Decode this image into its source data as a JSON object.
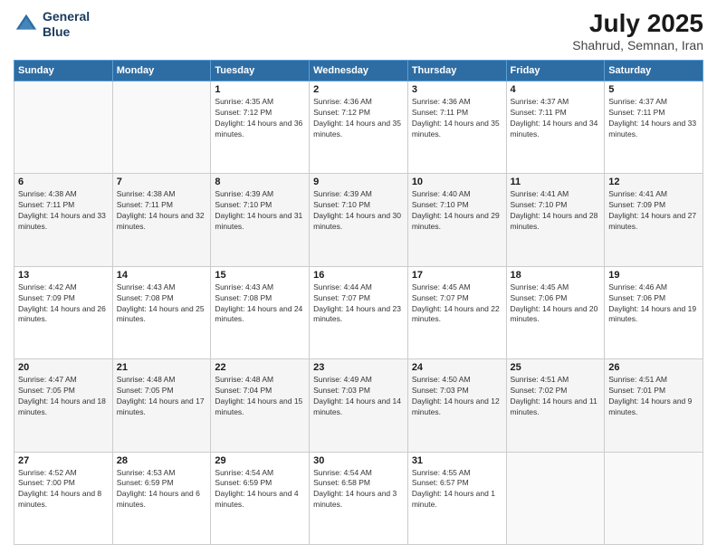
{
  "header": {
    "logo_line1": "General",
    "logo_line2": "Blue",
    "month": "July 2025",
    "location": "Shahrud, Semnan, Iran"
  },
  "weekdays": [
    "Sunday",
    "Monday",
    "Tuesday",
    "Wednesday",
    "Thursday",
    "Friday",
    "Saturday"
  ],
  "weeks": [
    [
      {
        "day": "",
        "sunrise": "",
        "sunset": "",
        "daylight": ""
      },
      {
        "day": "",
        "sunrise": "",
        "sunset": "",
        "daylight": ""
      },
      {
        "day": "1",
        "sunrise": "Sunrise: 4:35 AM",
        "sunset": "Sunset: 7:12 PM",
        "daylight": "Daylight: 14 hours and 36 minutes."
      },
      {
        "day": "2",
        "sunrise": "Sunrise: 4:36 AM",
        "sunset": "Sunset: 7:12 PM",
        "daylight": "Daylight: 14 hours and 35 minutes."
      },
      {
        "day": "3",
        "sunrise": "Sunrise: 4:36 AM",
        "sunset": "Sunset: 7:11 PM",
        "daylight": "Daylight: 14 hours and 35 minutes."
      },
      {
        "day": "4",
        "sunrise": "Sunrise: 4:37 AM",
        "sunset": "Sunset: 7:11 PM",
        "daylight": "Daylight: 14 hours and 34 minutes."
      },
      {
        "day": "5",
        "sunrise": "Sunrise: 4:37 AM",
        "sunset": "Sunset: 7:11 PM",
        "daylight": "Daylight: 14 hours and 33 minutes."
      }
    ],
    [
      {
        "day": "6",
        "sunrise": "Sunrise: 4:38 AM",
        "sunset": "Sunset: 7:11 PM",
        "daylight": "Daylight: 14 hours and 33 minutes."
      },
      {
        "day": "7",
        "sunrise": "Sunrise: 4:38 AM",
        "sunset": "Sunset: 7:11 PM",
        "daylight": "Daylight: 14 hours and 32 minutes."
      },
      {
        "day": "8",
        "sunrise": "Sunrise: 4:39 AM",
        "sunset": "Sunset: 7:10 PM",
        "daylight": "Daylight: 14 hours and 31 minutes."
      },
      {
        "day": "9",
        "sunrise": "Sunrise: 4:39 AM",
        "sunset": "Sunset: 7:10 PM",
        "daylight": "Daylight: 14 hours and 30 minutes."
      },
      {
        "day": "10",
        "sunrise": "Sunrise: 4:40 AM",
        "sunset": "Sunset: 7:10 PM",
        "daylight": "Daylight: 14 hours and 29 minutes."
      },
      {
        "day": "11",
        "sunrise": "Sunrise: 4:41 AM",
        "sunset": "Sunset: 7:10 PM",
        "daylight": "Daylight: 14 hours and 28 minutes."
      },
      {
        "day": "12",
        "sunrise": "Sunrise: 4:41 AM",
        "sunset": "Sunset: 7:09 PM",
        "daylight": "Daylight: 14 hours and 27 minutes."
      }
    ],
    [
      {
        "day": "13",
        "sunrise": "Sunrise: 4:42 AM",
        "sunset": "Sunset: 7:09 PM",
        "daylight": "Daylight: 14 hours and 26 minutes."
      },
      {
        "day": "14",
        "sunrise": "Sunrise: 4:43 AM",
        "sunset": "Sunset: 7:08 PM",
        "daylight": "Daylight: 14 hours and 25 minutes."
      },
      {
        "day": "15",
        "sunrise": "Sunrise: 4:43 AM",
        "sunset": "Sunset: 7:08 PM",
        "daylight": "Daylight: 14 hours and 24 minutes."
      },
      {
        "day": "16",
        "sunrise": "Sunrise: 4:44 AM",
        "sunset": "Sunset: 7:07 PM",
        "daylight": "Daylight: 14 hours and 23 minutes."
      },
      {
        "day": "17",
        "sunrise": "Sunrise: 4:45 AM",
        "sunset": "Sunset: 7:07 PM",
        "daylight": "Daylight: 14 hours and 22 minutes."
      },
      {
        "day": "18",
        "sunrise": "Sunrise: 4:45 AM",
        "sunset": "Sunset: 7:06 PM",
        "daylight": "Daylight: 14 hours and 20 minutes."
      },
      {
        "day": "19",
        "sunrise": "Sunrise: 4:46 AM",
        "sunset": "Sunset: 7:06 PM",
        "daylight": "Daylight: 14 hours and 19 minutes."
      }
    ],
    [
      {
        "day": "20",
        "sunrise": "Sunrise: 4:47 AM",
        "sunset": "Sunset: 7:05 PM",
        "daylight": "Daylight: 14 hours and 18 minutes."
      },
      {
        "day": "21",
        "sunrise": "Sunrise: 4:48 AM",
        "sunset": "Sunset: 7:05 PM",
        "daylight": "Daylight: 14 hours and 17 minutes."
      },
      {
        "day": "22",
        "sunrise": "Sunrise: 4:48 AM",
        "sunset": "Sunset: 7:04 PM",
        "daylight": "Daylight: 14 hours and 15 minutes."
      },
      {
        "day": "23",
        "sunrise": "Sunrise: 4:49 AM",
        "sunset": "Sunset: 7:03 PM",
        "daylight": "Daylight: 14 hours and 14 minutes."
      },
      {
        "day": "24",
        "sunrise": "Sunrise: 4:50 AM",
        "sunset": "Sunset: 7:03 PM",
        "daylight": "Daylight: 14 hours and 12 minutes."
      },
      {
        "day": "25",
        "sunrise": "Sunrise: 4:51 AM",
        "sunset": "Sunset: 7:02 PM",
        "daylight": "Daylight: 14 hours and 11 minutes."
      },
      {
        "day": "26",
        "sunrise": "Sunrise: 4:51 AM",
        "sunset": "Sunset: 7:01 PM",
        "daylight": "Daylight: 14 hours and 9 minutes."
      }
    ],
    [
      {
        "day": "27",
        "sunrise": "Sunrise: 4:52 AM",
        "sunset": "Sunset: 7:00 PM",
        "daylight": "Daylight: 14 hours and 8 minutes."
      },
      {
        "day": "28",
        "sunrise": "Sunrise: 4:53 AM",
        "sunset": "Sunset: 6:59 PM",
        "daylight": "Daylight: 14 hours and 6 minutes."
      },
      {
        "day": "29",
        "sunrise": "Sunrise: 4:54 AM",
        "sunset": "Sunset: 6:59 PM",
        "daylight": "Daylight: 14 hours and 4 minutes."
      },
      {
        "day": "30",
        "sunrise": "Sunrise: 4:54 AM",
        "sunset": "Sunset: 6:58 PM",
        "daylight": "Daylight: 14 hours and 3 minutes."
      },
      {
        "day": "31",
        "sunrise": "Sunrise: 4:55 AM",
        "sunset": "Sunset: 6:57 PM",
        "daylight": "Daylight: 14 hours and 1 minute."
      },
      {
        "day": "",
        "sunrise": "",
        "sunset": "",
        "daylight": ""
      },
      {
        "day": "",
        "sunrise": "",
        "sunset": "",
        "daylight": ""
      }
    ]
  ]
}
